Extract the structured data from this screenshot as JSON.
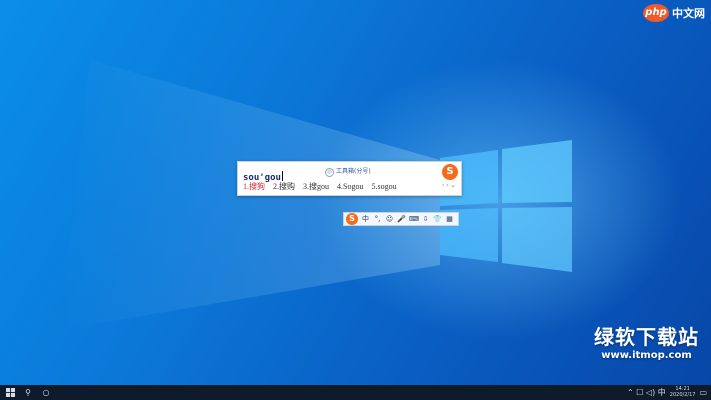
{
  "ime": {
    "composition": "sou'gou",
    "hint_text": "工具箱(分号)",
    "logo_letter": "S",
    "candidates": [
      "1.搜狗",
      "2.搜购",
      "3.搜gou",
      "4.Sogou",
      "5.sogou"
    ],
    "nav_prev": "‹",
    "nav_next": "›",
    "nav_down": "⌄"
  },
  "status_bar": {
    "logo_letter": "S",
    "mode": "中",
    "punct": "°,",
    "emoji": "☺",
    "mic": "🎤",
    "keyboard": "⌨",
    "download": "⇩",
    "skin": "👕",
    "grid": "▦"
  },
  "watermark": {
    "title": "绿软下载站",
    "url": "www.itmop.com"
  },
  "php_badge": {
    "logo": "php",
    "text": "中文网"
  },
  "taskbar": {
    "start_icon": "windows-logo",
    "search_glyph": "⚲",
    "cortana_glyph": "○",
    "tray_glyphs": "⌃ ☐ ◁) 中",
    "time": "14:21",
    "date": "2020/2/17"
  },
  "colors": {
    "accent_orange": "#f36b1c",
    "selected_candidate": "#e0242e",
    "taskbar": "#0f1a2b"
  }
}
